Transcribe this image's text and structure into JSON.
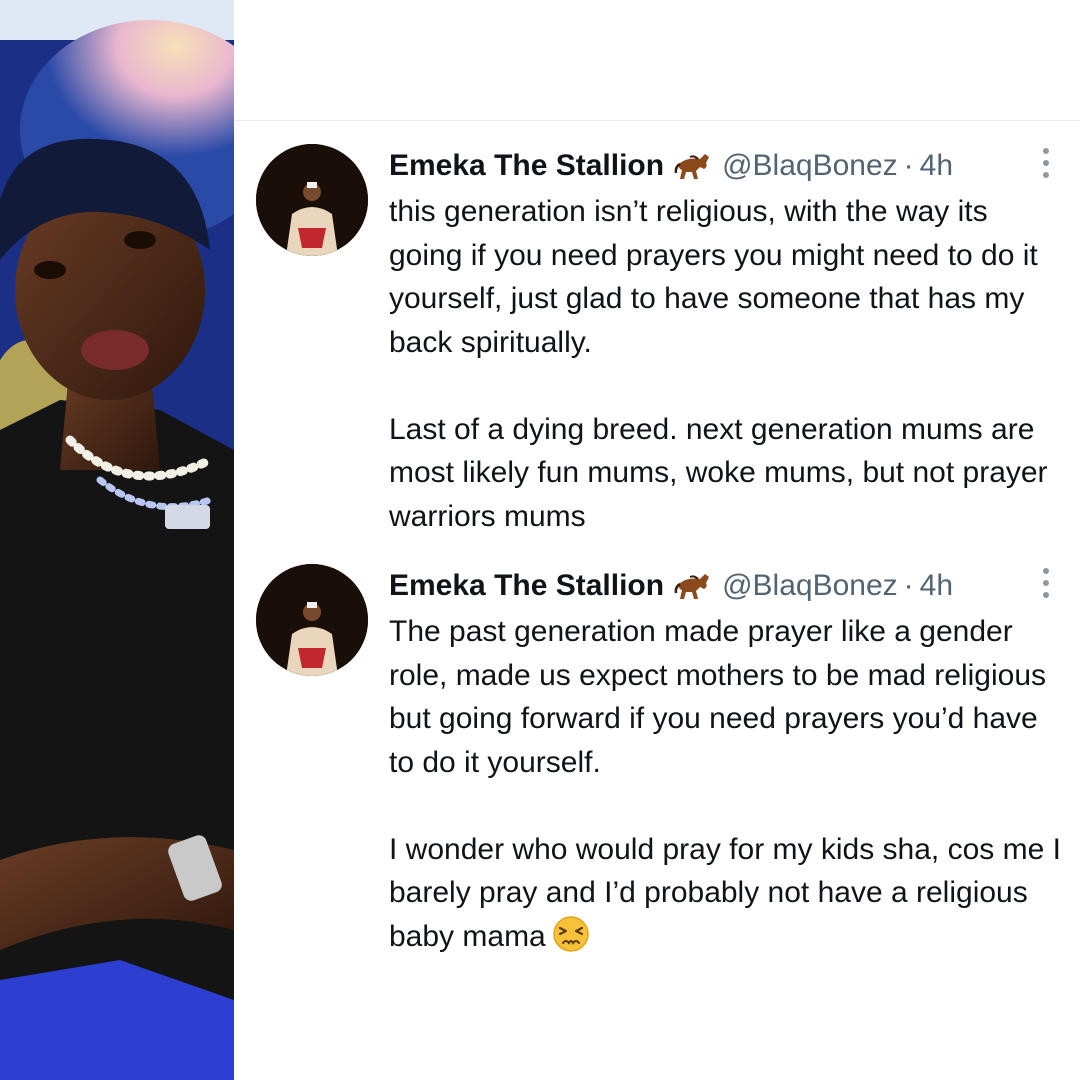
{
  "tweets": [
    {
      "name": "Emeka The Stallion",
      "name_icon": "horse-emoji",
      "handle": "@BlaqBonez",
      "separator": "·",
      "time": "4h",
      "paragraphs": [
        "this generation isn’t religious, with the way its going if you need prayers you might need to do it yourself, just glad to have someone that has my back spiritually.",
        "Last of a dying breed. next generation mums are most likely fun mums, woke mums, but not prayer warriors mums"
      ]
    },
    {
      "name": "Emeka The Stallion",
      "name_icon": "horse-emoji",
      "handle": "@BlaqBonez",
      "separator": "·",
      "time": "4h",
      "paragraphs": [
        "The past generation made prayer like a gender role, made us expect mothers to be mad religious but going forward if you need prayers you’d have to do it yourself.",
        "I wonder who would pray for my kids sha, cos me I barely pray and I’d probably not have a religious baby mama"
      ],
      "trailing_icon": "persevering-face-emoji"
    }
  ],
  "colors": {
    "name": "#0f1419",
    "meta": "#536471",
    "divider": "#e6ecf0",
    "photo_background": "#1b2f7a"
  }
}
